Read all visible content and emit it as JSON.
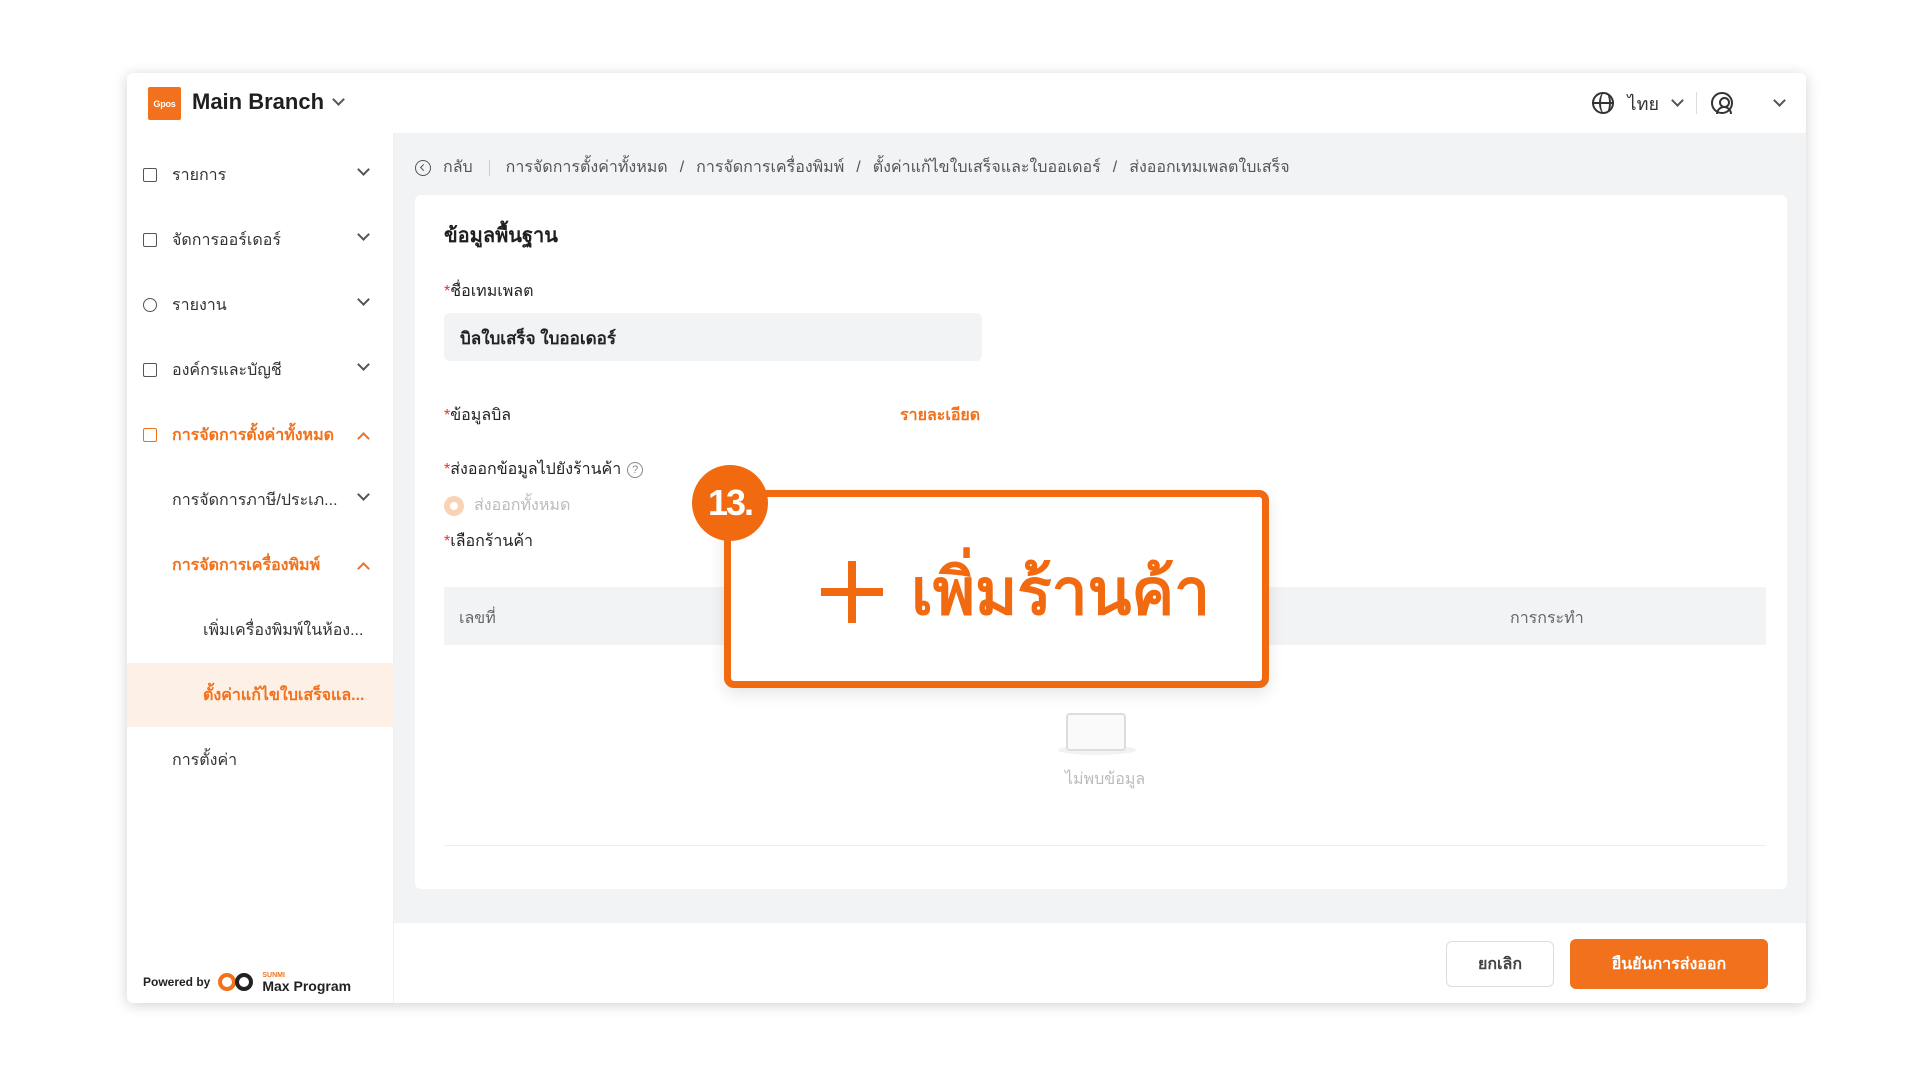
{
  "header": {
    "logo_text": "Gpos",
    "branch": "Main Branch",
    "language": "ไทย"
  },
  "sidebar": {
    "items": [
      {
        "label": "รายการ",
        "icon": "list-icon"
      },
      {
        "label": "จัดการออร์เดอร์",
        "icon": "clipboard-icon"
      },
      {
        "label": "รายงาน",
        "icon": "clock-icon"
      },
      {
        "label": "องค์กรและบัญชี",
        "icon": "people-icon"
      },
      {
        "label": "การจัดการตั้งค่าทั้งหมด",
        "icon": "settings-board-icon"
      }
    ],
    "sub_items": [
      {
        "label": "การจัดการภาษี/ประเภ..."
      },
      {
        "label": "การจัดการเครื่องพิมพ์"
      }
    ],
    "sub2_items": [
      {
        "label": "เพิ่มเครื่องพิมพ์ในห้อง..."
      },
      {
        "label": "ตั้งค่าแก้ไขใบเสร็จแล..."
      }
    ],
    "settings_label": "การตั้งค่า",
    "powered_by": "Powered by",
    "brand_small": "SUNMI",
    "brand": "Max Program"
  },
  "breadcrumb": {
    "back": "กลับ",
    "items": [
      "การจัดการตั้งค่าทั้งหมด",
      "การจัดการเครื่องพิมพ์",
      "ตั้งค่าแก้ไขใบเสร็จและใบออเดอร์",
      "ส่งออกเทมเพลตใบเสร็จ"
    ],
    "separator": "/"
  },
  "form": {
    "section_title": "ข้อมูลพื้นฐาน",
    "required_mark": "*",
    "template_name_label": "ชื่อเทมเพลต",
    "template_name_value": "บิลใบเสร็จ ใบออเดอร์",
    "bill_info_label": "ข้อมูลบิล",
    "detail_link": "รายละเอียด",
    "export_to_store_label": "ส่งออกข้อมูลไปยังร้านค้า",
    "help_glyph": "?",
    "export_all_option": "ส่งออกทั้งหมด",
    "select_store_label": "เลือกร้านค้า",
    "table_headers": [
      "เลขที่",
      "การกระทำ"
    ],
    "empty_text": "ไม่พบข้อมูล"
  },
  "footer": {
    "cancel": "ยกเลิก",
    "confirm": "ยืนยันการส่งออก"
  },
  "callout": {
    "step": "13.",
    "label": "เพิ่มร้านค้า"
  },
  "colors": {
    "accent": "#f2711c",
    "required": "#e5332e"
  }
}
